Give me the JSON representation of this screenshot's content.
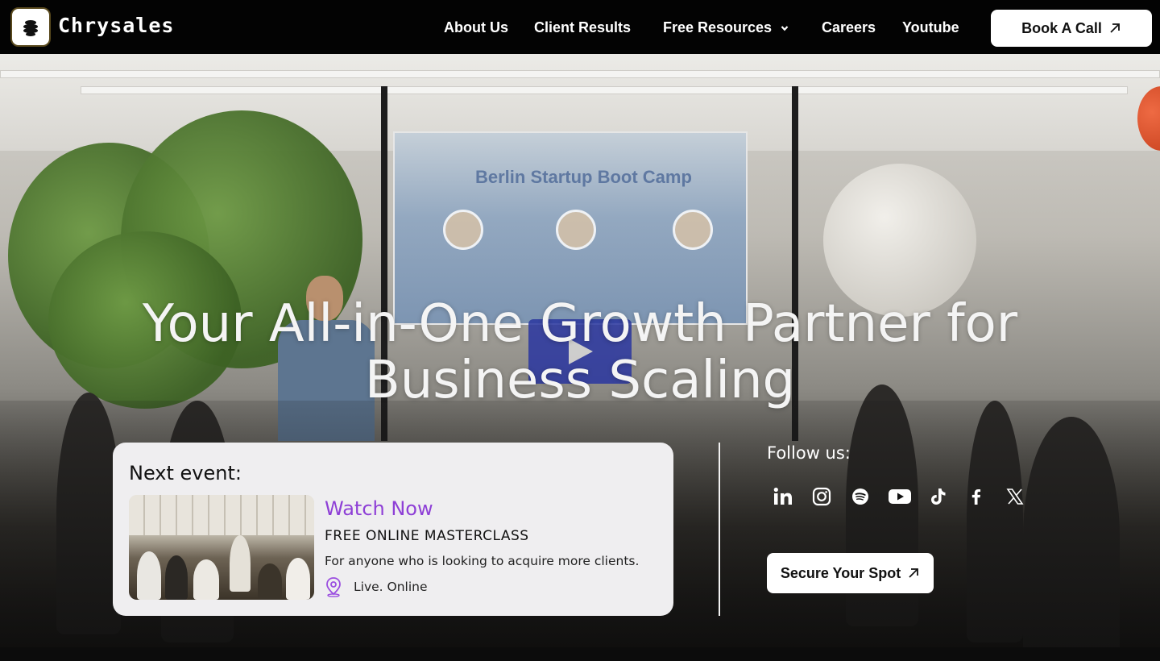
{
  "header": {
    "brand": "Chrysales",
    "nav": [
      {
        "label": "About Us"
      },
      {
        "label": "Client Results"
      },
      {
        "label": "Free Resources"
      },
      {
        "label": "Careers"
      },
      {
        "label": "Youtube"
      }
    ],
    "cta_label": "Book A Call"
  },
  "hero": {
    "title_line1": "Your All-in-One Growth Partner for",
    "title_line2": "Business Scaling",
    "video_screen_text": "Berlin Startup Boot Camp"
  },
  "event": {
    "heading": "Next event:",
    "watch_label": "Watch Now",
    "title": "FREE ONLINE MASTERCLASS",
    "description": "For anyone who is looking to acquire more clients.",
    "location": "Live. Online"
  },
  "follow": {
    "heading": "Follow us:",
    "icons": [
      "linkedin-icon",
      "instagram-icon",
      "spotify-icon",
      "youtube-icon",
      "tiktok-icon",
      "facebook-icon",
      "x-icon"
    ],
    "cta_label": "Secure Your Spot"
  },
  "colors": {
    "accent_purple": "#8e3fd6",
    "header_bg": "#030303",
    "card_bg": "#efeef0"
  }
}
